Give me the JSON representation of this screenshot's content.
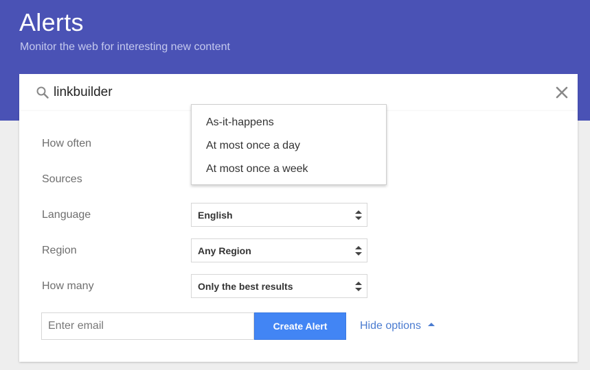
{
  "header": {
    "title": "Alerts",
    "subtitle": "Monitor the web for interesting new content",
    "background": "#4a52b5"
  },
  "search": {
    "icon": "search-icon",
    "value": "linkbuilder",
    "clear_icon": "close-icon"
  },
  "options": {
    "how_often": {
      "label": "How often"
    },
    "sources": {
      "label": "Sources"
    },
    "language": {
      "label": "Language",
      "value": "English"
    },
    "region": {
      "label": "Region",
      "value": "Any Region"
    },
    "how_many": {
      "label": "How many",
      "value": "Only the best results"
    }
  },
  "frequency_dropdown": {
    "items": [
      "As-it-happens",
      "At most once a day",
      "At most once a week"
    ]
  },
  "footer": {
    "email_placeholder": "Enter email",
    "create_label": "Create Alert",
    "hide_options_label": "Hide options",
    "accent": "#4285f4"
  }
}
